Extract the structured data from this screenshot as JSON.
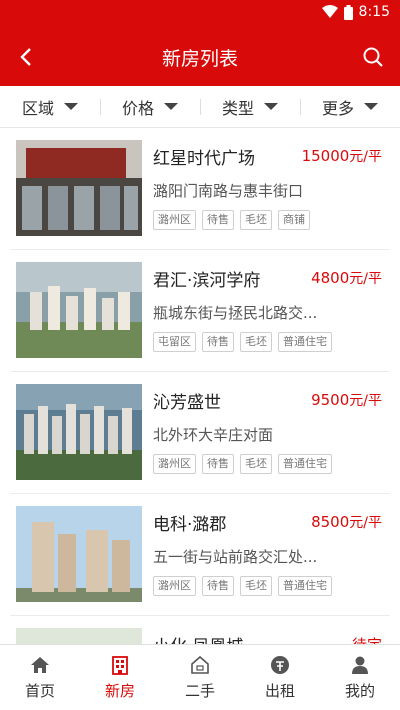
{
  "status": {
    "time": "8:15"
  },
  "header": {
    "title": "新房列表"
  },
  "filters": [
    {
      "label": "区域"
    },
    {
      "label": "价格"
    },
    {
      "label": "类型"
    },
    {
      "label": "更多"
    }
  ],
  "listings": [
    {
      "name": "红星时代广场",
      "price": "15000",
      "unit": "元/平",
      "address": "潞阳门南路与惠丰街口",
      "tags": [
        "潞州区",
        "待售",
        "毛坯",
        "商铺"
      ]
    },
    {
      "name": "君汇·滨河学府",
      "price": "4800",
      "unit": "元/平",
      "address": "瓶城东街与拯民北路交...",
      "tags": [
        "屯留区",
        "待售",
        "毛坯",
        "普通住宅"
      ]
    },
    {
      "name": "沁芳盛世",
      "price": "9500",
      "unit": "元/平",
      "address": "北外环大辛庄对面",
      "tags": [
        "潞州区",
        "待售",
        "毛坯",
        "普通住宅"
      ]
    },
    {
      "name": "电科·潞郡",
      "price": "8500",
      "unit": "元/平",
      "address": "五一街与站前路交汇处...",
      "tags": [
        "潞州区",
        "待售",
        "毛坯",
        "普通住宅"
      ]
    },
    {
      "name": "小化·凤凰城",
      "price": "待定",
      "unit": "",
      "address": "",
      "tags": []
    }
  ],
  "tabbar": [
    {
      "label": "首页",
      "icon": "home-icon"
    },
    {
      "label": "新房",
      "icon": "building-icon",
      "active": true
    },
    {
      "label": "二手",
      "icon": "house-icon"
    },
    {
      "label": "出租",
      "icon": "rent-icon"
    },
    {
      "label": "我的",
      "icon": "user-icon"
    }
  ],
  "colors": {
    "brand": "#d90a0a"
  }
}
